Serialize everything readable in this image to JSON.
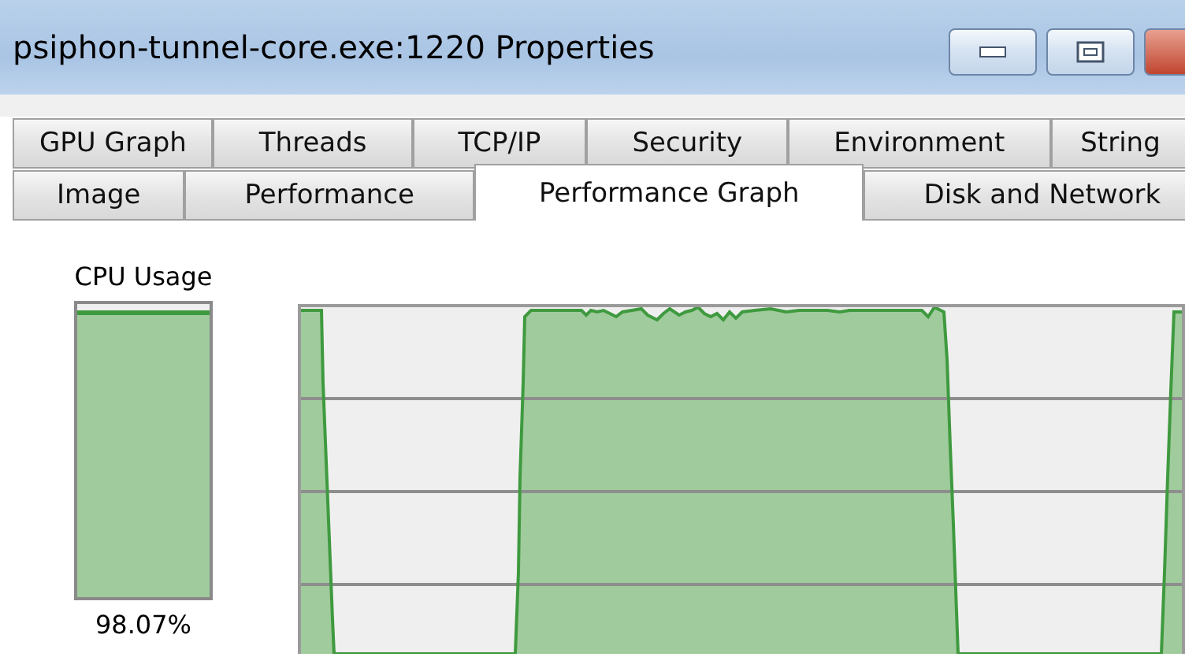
{
  "window": {
    "title": "psiphon-tunnel-core.exe:1220 Properties"
  },
  "tab_rows": [
    [
      {
        "label": "GPU Graph",
        "selected": false
      },
      {
        "label": "Threads",
        "selected": false
      },
      {
        "label": "TCP/IP",
        "selected": false
      },
      {
        "label": "Security",
        "selected": false
      },
      {
        "label": "Environment",
        "selected": false
      },
      {
        "label": "String",
        "selected": false
      }
    ],
    [
      {
        "label": "Image",
        "selected": false
      },
      {
        "label": "Performance",
        "selected": false
      },
      {
        "label": "Performance Graph",
        "selected": true
      },
      {
        "label": "Disk and Network",
        "selected": false
      }
    ]
  ],
  "cpu_usage": {
    "label": "CPU Usage",
    "level": 0.98,
    "reading": "98.07%"
  }
}
